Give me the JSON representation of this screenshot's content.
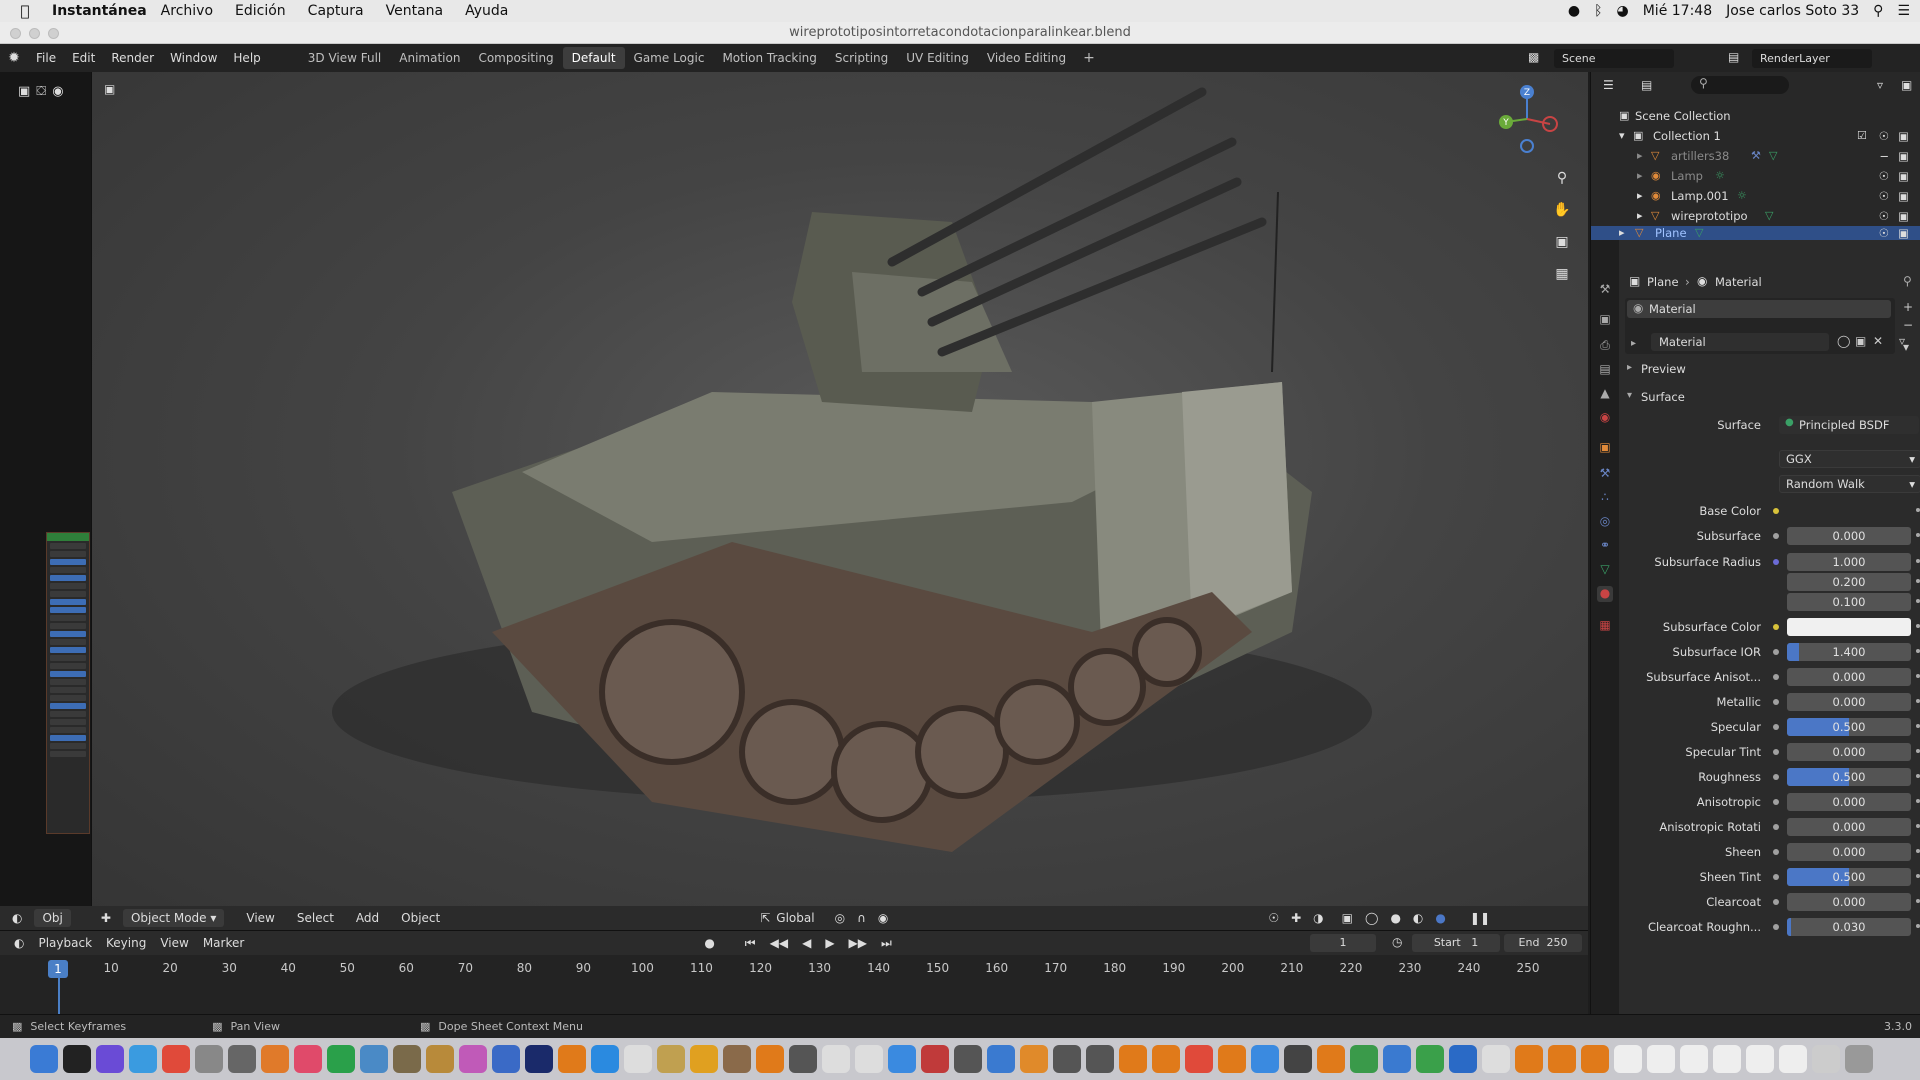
{
  "mac": {
    "app": "Instantánea",
    "menus": [
      "Archivo",
      "Edición",
      "Captura",
      "Ventana",
      "Ayuda"
    ],
    "clock": "Mié 17:48",
    "user": "Jose carlos Soto 33"
  },
  "window": {
    "title": "wireprototiposintorretacondotacionparalinkear.blend"
  },
  "topbar": {
    "menus": [
      "File",
      "Edit",
      "Render",
      "Window",
      "Help"
    ],
    "workspaces": [
      "3D View Full",
      "Animation",
      "Compositing",
      "Default",
      "Game Logic",
      "Motion Tracking",
      "Scripting",
      "UV Editing",
      "Video Editing"
    ],
    "active_workspace": "Default",
    "scene": "Scene",
    "render_layer": "RenderLayer"
  },
  "viewport_footer": {
    "editor_short": "Obj",
    "mode": "Object Mode",
    "menus": [
      "View",
      "Select",
      "Add",
      "Object"
    ],
    "orientation": "Global"
  },
  "timeline": {
    "menus": [
      "Playback",
      "Keying",
      "View",
      "Marker"
    ],
    "current_frame": "1",
    "start_label": "Start",
    "start": "1",
    "end_label": "End",
    "end": "250",
    "ticks": [
      "1",
      "10",
      "20",
      "30",
      "40",
      "50",
      "60",
      "70",
      "80",
      "90",
      "100",
      "110",
      "120",
      "130",
      "140",
      "150",
      "160",
      "170",
      "180",
      "190",
      "200",
      "210",
      "220",
      "230",
      "240",
      "250"
    ]
  },
  "status": {
    "left": "Select Keyframes",
    "middle": "Pan View",
    "right": "Dope Sheet Context Menu",
    "version": "3.3.0"
  },
  "outliner": {
    "scene_collection": "Scene Collection",
    "collection": "Collection 1",
    "items": [
      "artillers38",
      "Lamp",
      "Lamp.001",
      "wireprototipo",
      "Plane"
    ],
    "selected": "Plane"
  },
  "properties": {
    "breadcrumb_object": "Plane",
    "breadcrumb_data": "Material",
    "slot_name": "Material",
    "material_name": "Material",
    "preview_label": "Preview",
    "surface_panel": "Surface",
    "surface_label": "Surface",
    "surface_shader": "Principled BSDF",
    "distribution": "GGX",
    "subsurface_method": "Random Walk",
    "rows": [
      {
        "label": "Base Color",
        "value": "",
        "type": "color-empty",
        "dot": "#d8c23a"
      },
      {
        "label": "Subsurface",
        "value": "0.000",
        "fill": 0,
        "dot": "#a0a0a0"
      },
      {
        "label": "Subsurface Radius",
        "value": "1.000",
        "fill": 0,
        "dot": "#6b6bd6"
      },
      {
        "label": "",
        "value": "0.200",
        "fill": 0,
        "dot": ""
      },
      {
        "label": "",
        "value": "0.100",
        "fill": 0,
        "dot": ""
      },
      {
        "label": "Subsurface Color",
        "value": "",
        "type": "color-white",
        "dot": "#d8c23a"
      },
      {
        "label": "Subsurface IOR",
        "value": "1.400",
        "fill": 0.1,
        "dot": "#a0a0a0"
      },
      {
        "label": "Subsurface Anisot...",
        "value": "0.000",
        "fill": 0,
        "dot": "#a0a0a0"
      },
      {
        "label": "Metallic",
        "value": "0.000",
        "fill": 0,
        "dot": "#a0a0a0"
      },
      {
        "label": "Specular",
        "value": "0.500",
        "fill": 0.5,
        "dot": "#a0a0a0"
      },
      {
        "label": "Specular Tint",
        "value": "0.000",
        "fill": 0,
        "dot": "#a0a0a0"
      },
      {
        "label": "Roughness",
        "value": "0.500",
        "fill": 0.5,
        "dot": "#a0a0a0"
      },
      {
        "label": "Anisotropic",
        "value": "0.000",
        "fill": 0,
        "dot": "#a0a0a0"
      },
      {
        "label": "Anisotropic Rotati",
        "value": "0.000",
        "fill": 0,
        "dot": "#a0a0a0"
      },
      {
        "label": "Sheen",
        "value": "0.000",
        "fill": 0,
        "dot": "#a0a0a0"
      },
      {
        "label": "Sheen Tint",
        "value": "0.500",
        "fill": 0.5,
        "dot": "#a0a0a0"
      },
      {
        "label": "Clearcoat",
        "value": "0.000",
        "fill": 0,
        "dot": "#a0a0a0"
      },
      {
        "label": "Clearcoat Roughn...",
        "value": "0.030",
        "fill": 0.03,
        "dot": "#a0a0a0"
      }
    ]
  },
  "colors": {
    "accent": "#4b77c6",
    "selected": "#2f4f88",
    "bg": "#2b2b2b"
  }
}
